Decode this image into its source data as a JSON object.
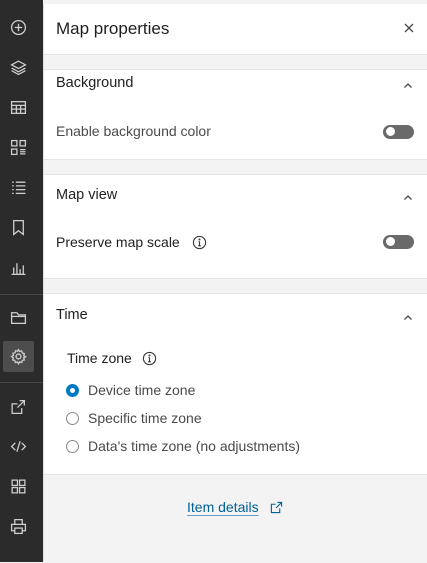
{
  "toolbar": {
    "items": [
      {
        "icon": "add-icon"
      },
      {
        "icon": "layers-icon"
      },
      {
        "icon": "table-icon"
      },
      {
        "icon": "legend-icon"
      },
      {
        "icon": "list-icon"
      },
      {
        "icon": "bookmark-icon"
      },
      {
        "icon": "chart-icon"
      },
      {
        "icon": "folder-icon"
      },
      {
        "icon": "gear-icon",
        "active": true
      },
      {
        "icon": "share-icon"
      },
      {
        "icon": "code-icon"
      },
      {
        "icon": "apps-icon"
      },
      {
        "icon": "print-icon"
      }
    ]
  },
  "panel": {
    "title": "Map properties",
    "close_icon": "close-icon"
  },
  "background": {
    "title": "Background",
    "enable_label": "Enable background color",
    "enabled": false
  },
  "map_view": {
    "title": "Map view",
    "preserve_label": "Preserve map scale",
    "enabled": false
  },
  "time": {
    "title": "Time",
    "zone_label": "Time zone",
    "options": [
      {
        "label": "Device time zone",
        "checked": true
      },
      {
        "label": "Specific time zone",
        "checked": false
      },
      {
        "label": "Data's time zone (no adjustments)",
        "checked": false
      }
    ]
  },
  "footer": {
    "item_details": "Item details"
  },
  "colors": {
    "accent": "#007ac2",
    "link": "#00619b",
    "toolbar_bg": "#2b2b2b"
  }
}
